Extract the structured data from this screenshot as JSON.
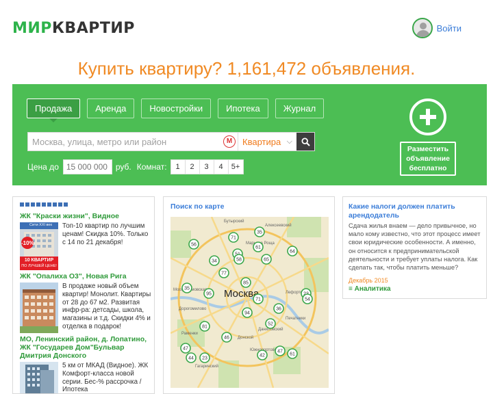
{
  "header": {
    "logo_mir": "МИР",
    "logo_kv": "КВАРТИР",
    "login_label": "Войти"
  },
  "headline": "Купить квартиру? 1,161,472 объявления.",
  "search_panel": {
    "tabs": [
      {
        "label": "Продажа",
        "active": true
      },
      {
        "label": "Аренда",
        "active": false
      },
      {
        "label": "Новостройки",
        "active": false
      },
      {
        "label": "Ипотека",
        "active": false
      },
      {
        "label": "Журнал",
        "active": false
      }
    ],
    "search_placeholder": "Москва, улица, метро или район",
    "metro_glyph": "M",
    "property_type": "Квартира",
    "price_label": "Цена до",
    "price_placeholder": "15 000 000",
    "currency": "руб.",
    "rooms_label": "Комнат:",
    "rooms": [
      "1",
      "2",
      "3",
      "4",
      "5+"
    ],
    "post_button": "Разместить объявление бесплатно"
  },
  "ads": [
    {
      "title": "ЖК \"Краски жизни\", Видное",
      "text": "Топ-10 квартир по лучшим ценам! Скидка 10%. Только с 14 по 21 декабря!",
      "badge_discount": "-10%",
      "badge_top": "10 КВАРТИР",
      "badge_bottom": "ПО ЛУЧШЕЙ ЦЕНЕ!",
      "brand": "Сити XXI век"
    },
    {
      "title": "ЖК \"Опалиха О3\", Новая Рига",
      "text": "В продаже новый объем квартир! Монолит. Квартиры от 28 до 67 м2. Развитая инфр-ра: детсады, школа, магазины и т.д. Скидки 4% и отделка в подарок!"
    },
    {
      "title": "МО, Ленинский район, д. Лопатино, ЖК \"Государев Дом\"Бульвар Дмитрия Донского",
      "text": "5 км от МКАД (Видное). ЖК Комфорт-класса новой серии. Бес-% рассрочка / Ипотека"
    }
  ],
  "map_section": {
    "title": "Поиск по карте",
    "city_label": "Москва",
    "districts": [
      "Бутырский",
      "Алексеевский",
      "Марьина Роща",
      "Раменки",
      "Донской",
      "Даниловский",
      "Лефортово",
      "Печатники",
      "Гагаринский",
      "Дорогомилово",
      "Южнопортовый",
      "Мосфильмовская"
    ],
    "markers": [
      "71",
      "35",
      "56",
      "51",
      "61",
      "64",
      "34",
      "58",
      "65",
      "77",
      "85",
      "71",
      "95",
      "35",
      "23",
      "81",
      "46",
      "52",
      "42",
      "44",
      "23",
      "47",
      "61",
      "54",
      "94",
      "36",
      "47"
    ]
  },
  "news": {
    "title": "Какие налоги должен платить арендодатель",
    "body": "Сдача жилья внаем — дело привычное, но мало кому известно, что этот процесс имеет свои юридические особенности. А именно, он относится к предпринимательской деятельности и требует уплаты налога. Как сделать так, чтобы платить меньше?",
    "date": "Декабрь 2015",
    "category": "Аналитика"
  },
  "colors": {
    "brand_green": "#4cbe54",
    "accent_orange": "#f08a24",
    "link_blue": "#3b7dd8"
  }
}
